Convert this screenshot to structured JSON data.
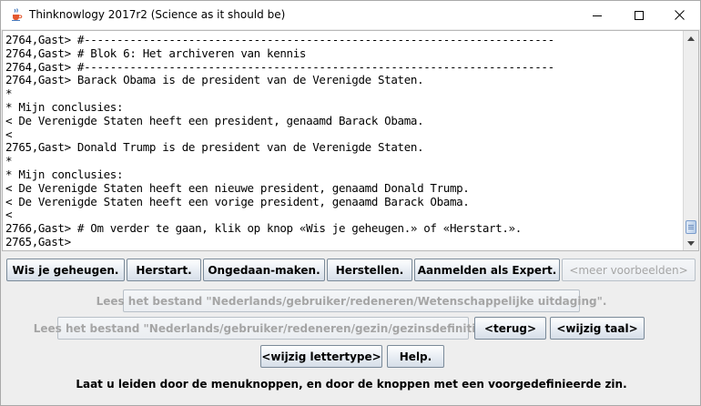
{
  "window": {
    "title": "Thinknowlogy 2017r2 (Science as it should be)",
    "icon": "java-coffee-icon"
  },
  "console": {
    "lines": [
      "2764,Gast> #------------------------------------------------------------------------",
      "2764,Gast> # Blok 6: Het archiveren van kennis",
      "2764,Gast> #------------------------------------------------------------------------",
      "2764,Gast> Barack Obama is de president van de Verenigde Staten.",
      "*",
      "* Mijn conclusies:",
      "< De Verenigde Staten heeft een president, genaamd Barack Obama.",
      "<",
      "2765,Gast> Donald Trump is de president van de Verenigde Staten.",
      "*",
      "* Mijn conclusies:",
      "< De Verenigde Staten heeft een nieuwe president, genaamd Donald Trump.",
      "< De Verenigde Staten heeft een vorige president, genaamd Barack Obama.",
      "<",
      "2766,Gast> # Om verder te gaan, klik op knop «Wis je geheugen.» of «Herstart.».",
      "2765,Gast>"
    ]
  },
  "buttons": {
    "row1": {
      "wis": "Wis je geheugen.",
      "herstart": "Herstart.",
      "ongedaan": "Ongedaan-maken.",
      "herstellen": "Herstellen.",
      "aanmelden": "Aanmelden als Expert.",
      "meer": "<meer voorbeelden>"
    },
    "lees_wetenschap": "Lees het bestand \"Nederlands/gebruiker/redeneren/Wetenschappelijke uitdaging\".",
    "lees_gezin": "Lees het bestand \"Nederlands/gebruiker/redeneren/gezin/gezinsdefinitie\".",
    "terug": "<terug>",
    "wijzig_taal": "<wijzig taal>",
    "wijzig_lettertype": "<wijzig lettertype>",
    "help": "Help."
  },
  "hint": "Laat u leiden door de menuknoppen, en door de knoppen met een voorgedefinieerde zin."
}
